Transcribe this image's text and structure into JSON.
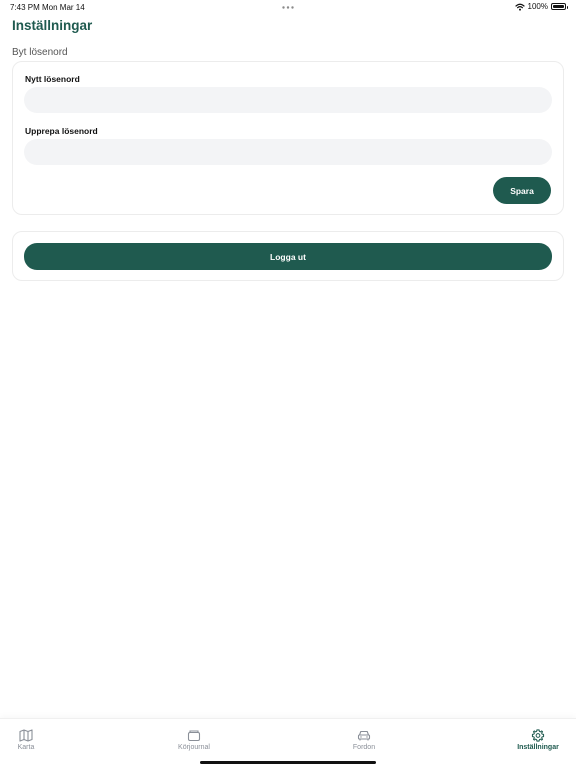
{
  "status_bar": {
    "time": "7:43 PM",
    "date": "Mon Mar 14",
    "battery_text": "100%",
    "battery_level": 1.0
  },
  "page": {
    "title": "Inställningar"
  },
  "change_password": {
    "section_label": "Byt lösenord",
    "new_password_label": "Nytt lösenord",
    "new_password_value": "",
    "repeat_password_label": "Upprepa lösenord",
    "repeat_password_value": "",
    "save_label": "Spara"
  },
  "logout": {
    "label": "Logga ut"
  },
  "tabs": [
    {
      "label": "Karta",
      "icon": "map-icon",
      "active": false
    },
    {
      "label": "Körjournal",
      "icon": "folder-icon",
      "active": false
    },
    {
      "label": "Fordon",
      "icon": "car-icon",
      "active": false
    },
    {
      "label": "Inställningar",
      "icon": "gear-icon",
      "active": true
    }
  ],
  "colors": {
    "accent": "#1f5a4f",
    "input_bg": "#f3f4f6",
    "inactive_tab": "#8a8f98"
  }
}
